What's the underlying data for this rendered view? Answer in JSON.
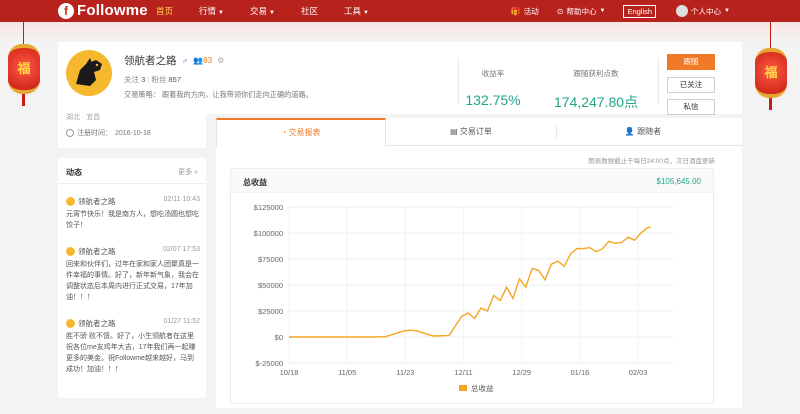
{
  "nav": {
    "logo_text": "Followme",
    "logo_badge": "f",
    "items": [
      {
        "label": "首页",
        "active": true,
        "caret": false
      },
      {
        "label": "行情",
        "active": false,
        "caret": true
      },
      {
        "label": "交易",
        "active": false,
        "caret": true
      },
      {
        "label": "社区",
        "active": false,
        "caret": false
      },
      {
        "label": "工具",
        "active": false,
        "caret": true
      }
    ],
    "activity_label": "活动",
    "help_label": "帮助中心",
    "language_label": "English",
    "user_label": "个人中心"
  },
  "decorations": {
    "lantern_char": "福"
  },
  "profile": {
    "name": "领航者之路",
    "fan_count": "83",
    "follow_label": "关注",
    "follow_count": "3",
    "fans_label": "粉丝",
    "fans_count": "857",
    "strategy_label": "交易策略：",
    "strategy_text": "跟着我的方向，让我带领你们走向正确的道路。",
    "region_text": "湖北 · 宜昌",
    "register_label": "注册时间：",
    "register_date": "2016-10-18"
  },
  "stats": {
    "return_label": "收益率",
    "return_value": "132.75%",
    "follow_profit_label": "跟随获利点数",
    "follow_profit_value": "174,247.80点"
  },
  "actions": {
    "follow_trade": "跟随",
    "followed": "已关注",
    "message": "私信"
  },
  "feed": {
    "title": "动态",
    "more": "更多",
    "posts": [
      {
        "author": "领航者之路",
        "time": "02/11 10:43",
        "text": "元宵节快乐！我是南方人，想吃汤圆也想吃饺子！"
      },
      {
        "author": "领航者之路",
        "time": "02/07 17:53",
        "text": "回来和伙伴们，过年在家和家人团聚真是一件幸福的事情。好了，新年新气象，我会在调整状态后本周内进行正式交易，17年加油！！！"
      },
      {
        "author": "领航者之路",
        "time": "01/27 11:52",
        "text": "胜不骄 败不馁。好了，小生领航者在这里祝各位me友鸡年大吉，17年我们再一起赚更多的美金。祝Followme越来越好，马到成功！加油！！！"
      }
    ]
  },
  "tabs": [
    {
      "label": "交易报表",
      "active": true,
      "icon": "chart-icon"
    },
    {
      "label": "交易订单",
      "active": false,
      "icon": "document-icon"
    },
    {
      "label": "跟随者",
      "active": false,
      "icon": "user-icon"
    }
  ],
  "note_text": "图表数据截止于每日24:00点，次日酒盘更新",
  "chart_card": {
    "title": "总收益",
    "total": "$105,645.00"
  },
  "colors": {
    "brand": "#b8221c",
    "accent": "#f07a27",
    "positive": "#22a587",
    "series": "#f5a623"
  },
  "chart_data": {
    "type": "line",
    "title": "总收益",
    "xlabel": "",
    "ylabel": "",
    "x_ticks": [
      "10/18",
      "11/05",
      "11/23",
      "12/11",
      "12/29",
      "01/16",
      "02/03"
    ],
    "y_ticks": [
      "$125000",
      "$100000",
      "$75000",
      "$50000",
      "$25000",
      "$0",
      "$-25000"
    ],
    "ylim": [
      -25000,
      125000
    ],
    "grid": true,
    "legend": "bottom",
    "series": [
      {
        "name": "总收益",
        "x": [
          0,
          10,
          20,
          25,
          30,
          36,
          38,
          40,
          45,
          50,
          54,
          56,
          58,
          60,
          62,
          64,
          66,
          68,
          70,
          72,
          74,
          76,
          78,
          80,
          82,
          84,
          86,
          88,
          90,
          92,
          94,
          96,
          98,
          100,
          102,
          104,
          106,
          108,
          110,
          112,
          113
        ],
        "values": [
          0,
          0,
          0,
          0,
          200,
          6000,
          6500,
          6000,
          1000,
          1500,
          20000,
          23000,
          18000,
          28000,
          25000,
          40000,
          35000,
          48000,
          37000,
          56000,
          48000,
          66000,
          64000,
          55000,
          70000,
          73000,
          68000,
          80000,
          85000,
          85000,
          86000,
          82000,
          85000,
          92000,
          90000,
          91000,
          96000,
          93000,
          100000,
          105000,
          105645
        ]
      }
    ]
  }
}
